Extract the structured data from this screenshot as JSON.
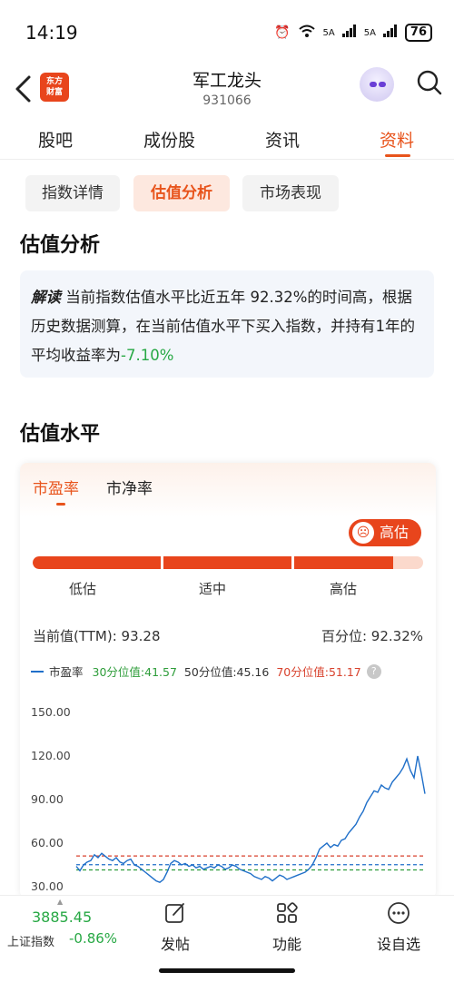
{
  "status_bar": {
    "time": "14:19",
    "signal1": "5A",
    "signal2": "5A",
    "battery": "76"
  },
  "header": {
    "title": "军工龙头",
    "code": "931066",
    "logo_line1": "东方",
    "logo_line2": "财富"
  },
  "tabs": [
    {
      "label": "股吧"
    },
    {
      "label": "成份股"
    },
    {
      "label": "资讯"
    },
    {
      "label": "资料",
      "active": true
    }
  ],
  "subtabs": [
    {
      "label": "指数详情"
    },
    {
      "label": "估值分析",
      "active": true
    },
    {
      "label": "市场表现"
    }
  ],
  "analysis": {
    "title": "估值分析",
    "tag": "解读",
    "text_before": "当前指数估值水平比近五年 92.32%的时间高，根据历史数据测算，在当前估值水平下买入指数，并持有1年的平均收益率为",
    "return_value": "-7.10%"
  },
  "valuation": {
    "title": "估值水平",
    "card_tabs": [
      {
        "label": "市盈率",
        "active": true
      },
      {
        "label": "市净率"
      }
    ],
    "badge": "高估",
    "level_percent": 92.32,
    "levels": [
      "低估",
      "适中",
      "高估"
    ],
    "current_label": "当前值(TTM):",
    "current_value": "93.28",
    "percentile_label": "百分位:",
    "percentile_value": "92.32%",
    "legend": {
      "series": "市盈率",
      "p30": "30分位值:41.57",
      "p50": "50分位值:45.16",
      "p70": "70分位值:51.17",
      "help": "?"
    }
  },
  "chart_data": {
    "type": "line",
    "series": [
      {
        "name": "市盈率",
        "values": [
          44,
          41,
          45,
          47,
          48,
          52,
          50,
          53,
          51,
          49,
          48,
          50,
          47,
          46,
          48,
          49,
          45,
          44,
          42,
          40,
          38,
          36,
          34,
          33,
          35,
          40,
          46,
          48,
          47,
          45,
          46,
          44,
          45,
          43,
          44,
          42,
          43,
          44,
          43,
          45,
          44,
          42,
          43,
          45,
          44,
          42,
          41,
          40,
          39,
          37,
          36,
          35,
          37,
          36,
          34,
          36,
          38,
          37,
          35,
          36,
          37,
          38,
          39,
          40,
          42,
          45,
          50,
          56,
          58,
          60,
          57,
          59,
          58,
          62,
          63,
          67,
          70,
          73,
          78,
          82,
          88,
          92,
          96,
          95,
          100,
          98,
          97,
          102,
          105,
          108,
          112,
          118,
          110,
          105,
          120,
          108,
          94
        ]
      }
    ],
    "reference_lines": [
      {
        "name": "30分位值",
        "value": 41.57,
        "color": "#2e9d3a"
      },
      {
        "name": "50分位值",
        "value": 45.16,
        "color": "#1f6fc9"
      },
      {
        "name": "70分位值",
        "value": 51.17,
        "color": "#d8412c"
      }
    ],
    "yticks": [
      "150.00",
      "120.00",
      "90.00",
      "60.00",
      "30.00"
    ],
    "ylim": [
      30,
      150
    ],
    "colors": {
      "line": "#1f6fc9"
    }
  },
  "bottom_bar": {
    "index_value": "3885.45",
    "index_name": "上证指数",
    "index_change": "-0.86%",
    "nav": [
      {
        "label": "发帖"
      },
      {
        "label": "功能"
      },
      {
        "label": "设自选"
      }
    ]
  }
}
